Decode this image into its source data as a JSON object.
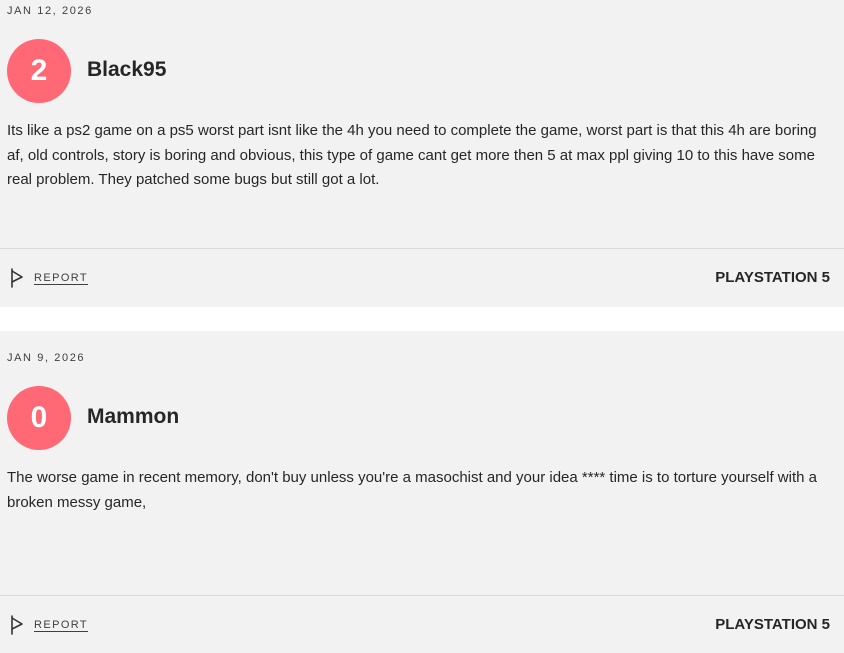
{
  "reviews": [
    {
      "date": "JAN 12, 2026",
      "score": "2",
      "username": "Black95",
      "text": "Its like a ps2 game on a ps5 worst part isnt like the 4h you need to complete the game, worst part is that this 4h are boring af, old controls, story is boring and obvious, this type of game cant get more then 5 at max ppl giving 10 to this have some real problem. They patched some bugs but still got a lot.",
      "report_label": "REPORT",
      "platform": "PLAYSTATION 5"
    },
    {
      "date": "JAN 9, 2026",
      "score": "0",
      "username": "Mammon",
      "text": "The worse game in recent memory, don't buy unless you're a masochist and your idea **** time is to torture yourself with a broken messy game,",
      "report_label": "REPORT",
      "platform": "PLAYSTATION 5"
    }
  ],
  "colors": {
    "score_badge": "#ff6874",
    "card_background": "#f2f2f2",
    "text": "#262626"
  },
  "icons": {
    "report": "flag-icon"
  }
}
